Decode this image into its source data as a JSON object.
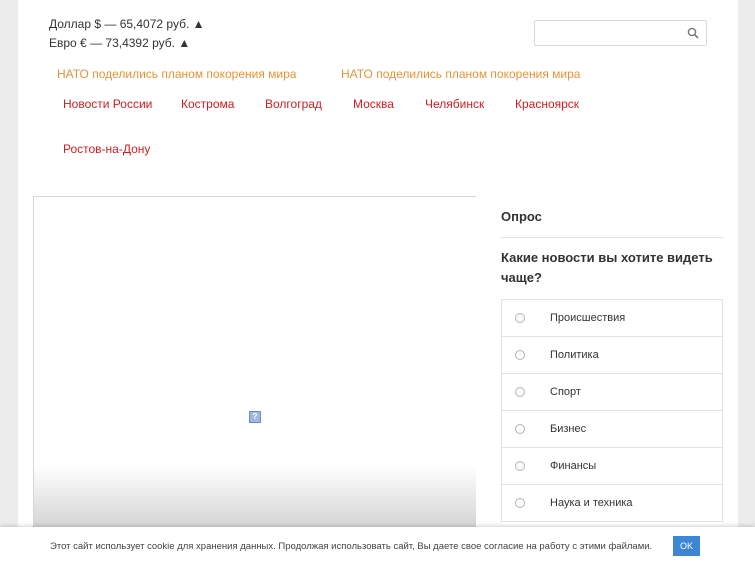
{
  "currency": {
    "dollar": "Доллар $ — 65,4072 руб. ▲",
    "euro": "Евро € — 73,4392 руб. ▲"
  },
  "search": {
    "placeholder": "",
    "icon": "search-icon"
  },
  "ticker": [
    "НАТО поделились планом покорения мира",
    "НАТО поделились планом покорения мира"
  ],
  "nav": [
    "Новости России",
    "Кострома",
    "Волгоград",
    "Москва",
    "Челябинск",
    "Красноярск",
    "Ростов-на-Дону"
  ],
  "media": {
    "broken_image_glyph": "?"
  },
  "poll": {
    "title": "Опрос",
    "question": "Какие новости вы хотите видеть чаще?",
    "options": [
      "Происшествия",
      "Политика",
      "Спорт",
      "Бизнес",
      "Финансы",
      "Наука и техника"
    ]
  },
  "cookie": {
    "message": "Этот сайт использует cookie для хранения данных. Продолжая использовать сайт, Вы даете свое согласие на работу с этими файлами.",
    "ok_label": "OK"
  },
  "colors": {
    "nav": "#cc1f1f",
    "ticker": "#e0953a",
    "ok_button": "#3d86d6"
  }
}
